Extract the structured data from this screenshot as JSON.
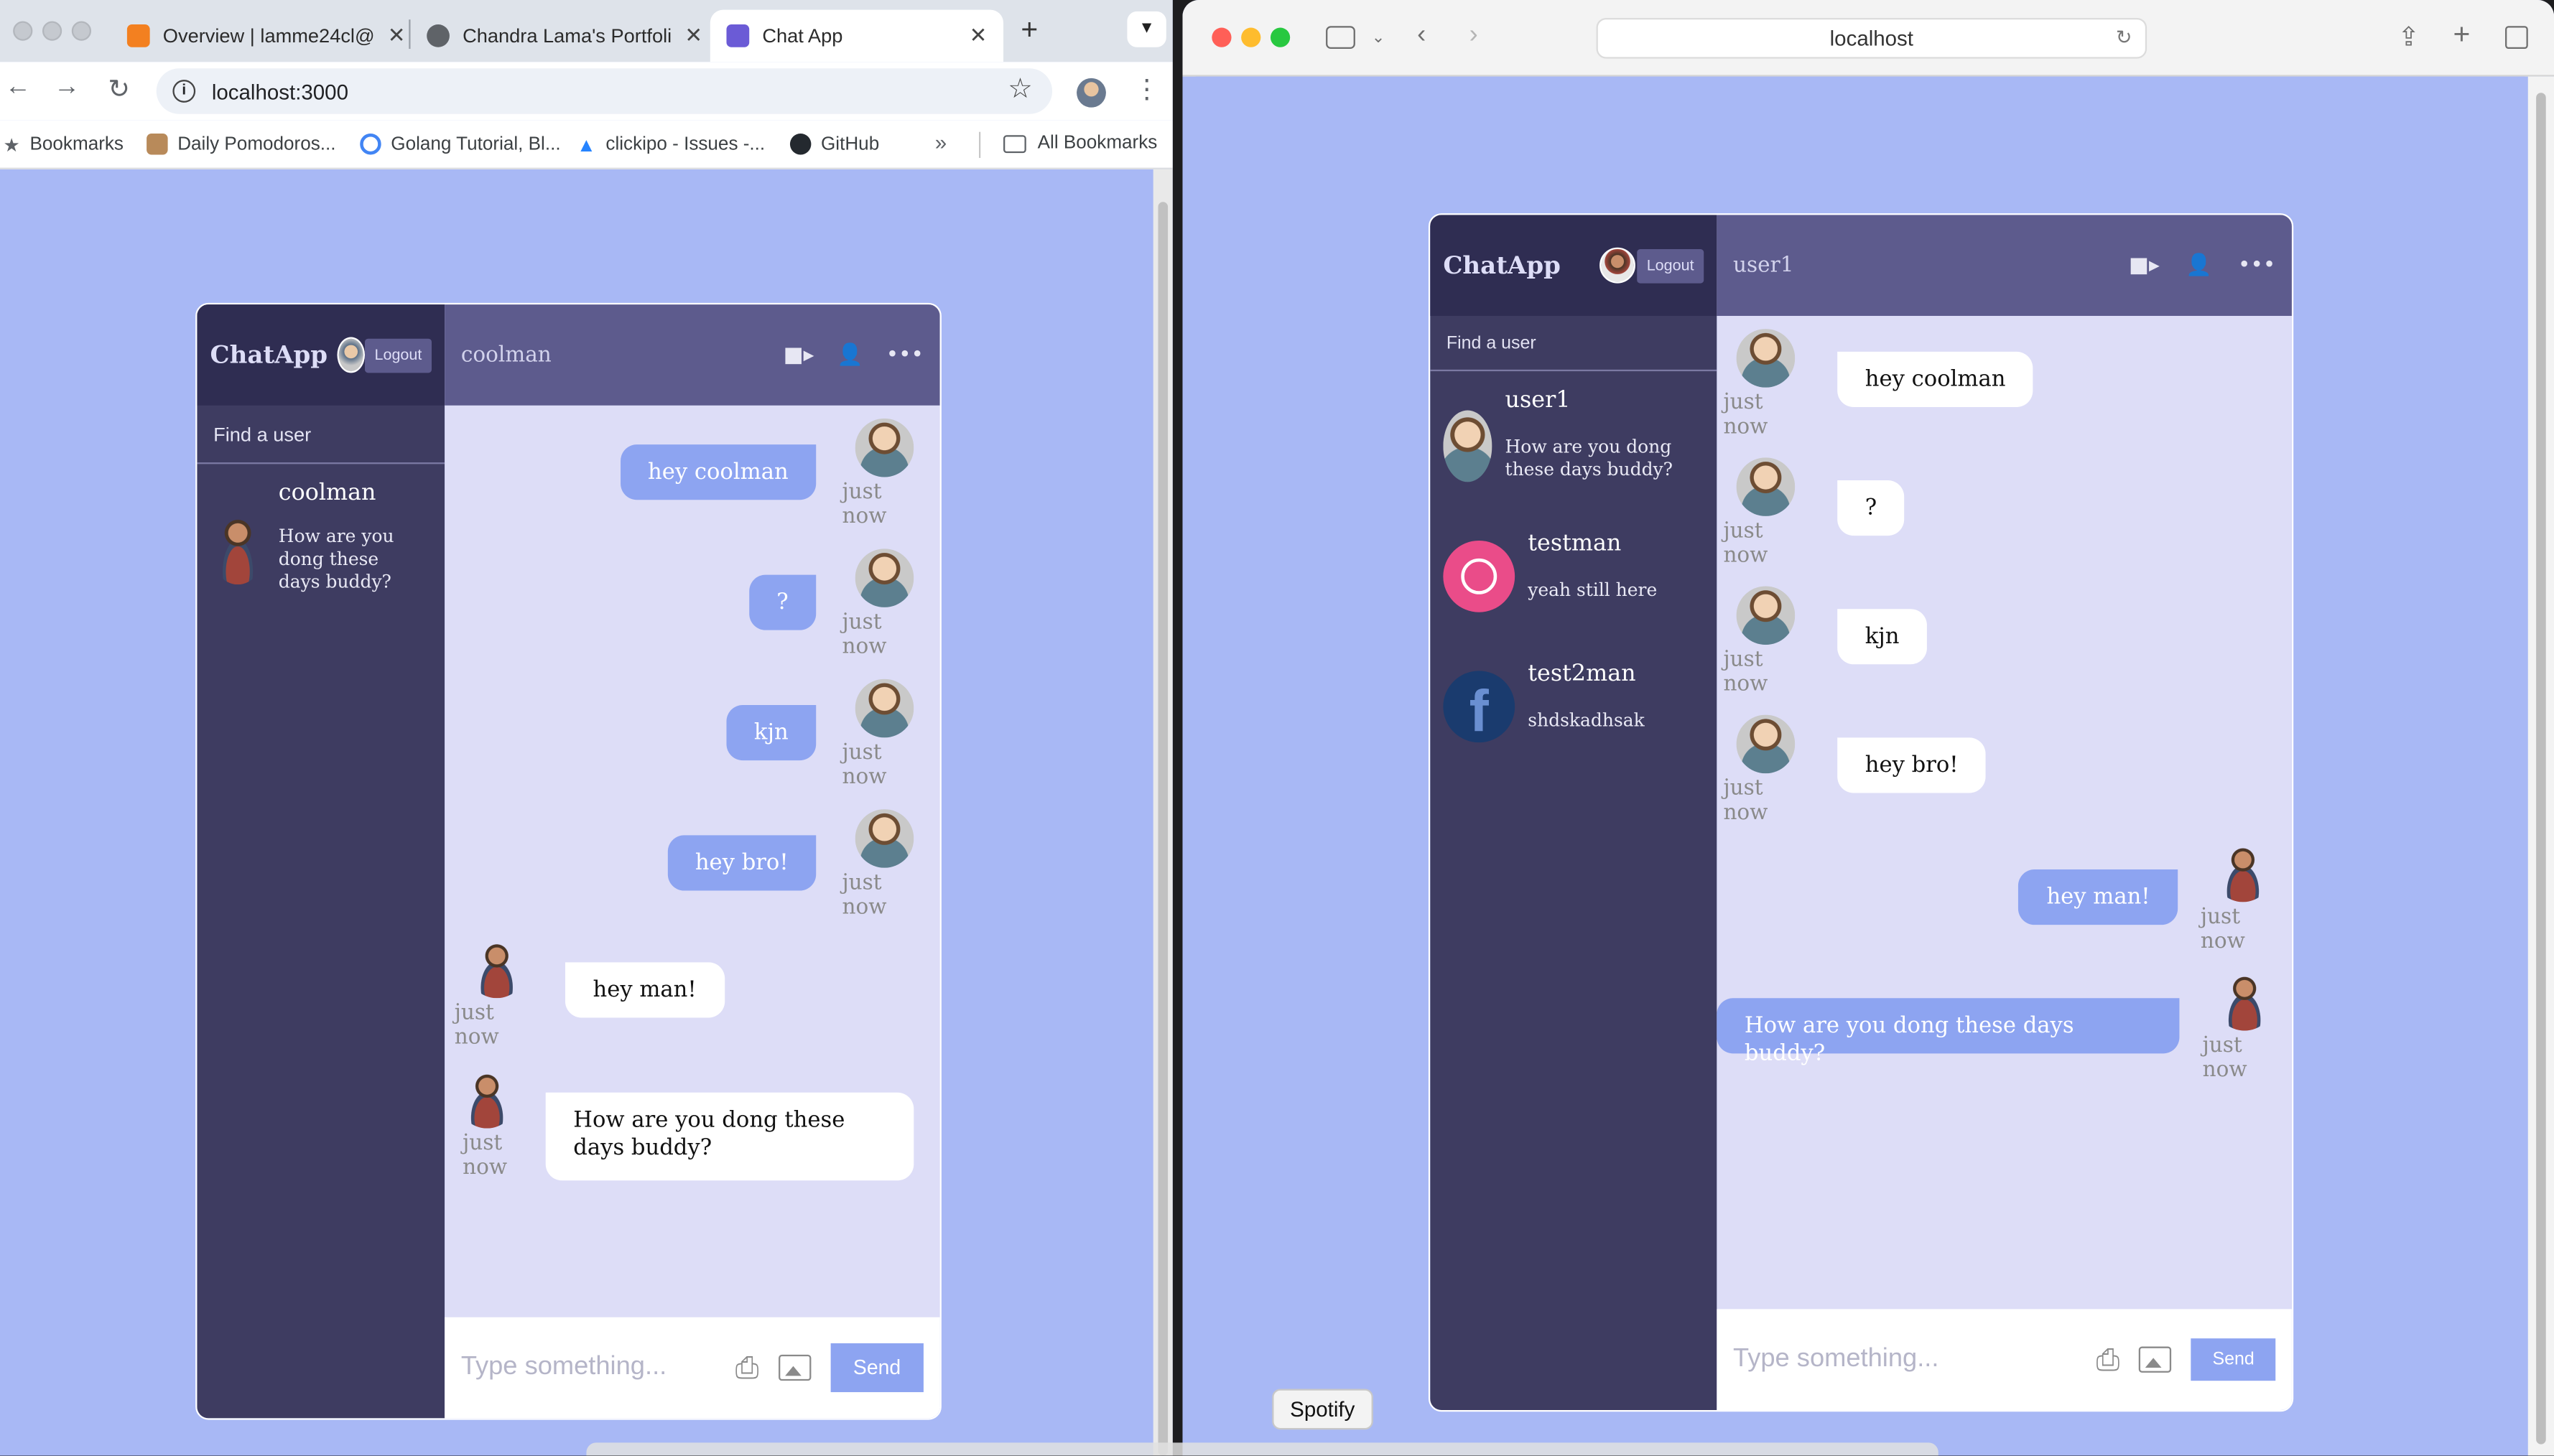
{
  "chrome": {
    "tabs": [
      {
        "title": "Overview | lamme24cl@",
        "icon_color": "#f38020"
      },
      {
        "title": "Chandra Lama's Portfoli",
        "icon_color": "#5f6368"
      },
      {
        "title": "Chat App",
        "icon_color": "#6b5bd6"
      }
    ],
    "url": "localhost:3000",
    "bookmarks": [
      {
        "label": "Bookmarks",
        "icon": "star-icon"
      },
      {
        "label": "Daily Pomodoros...",
        "icon": "pomodoro-icon"
      },
      {
        "label": "Golang Tutorial, Bl...",
        "icon": "google-icon"
      },
      {
        "label": "clickipo - Issues -...",
        "icon": "atlassian-icon"
      },
      {
        "label": "GitHub",
        "icon": "github-icon"
      },
      {
        "label": "All Bookmarks",
        "icon": "folder-icon"
      }
    ]
  },
  "safari": {
    "url": "localhost"
  },
  "tooltip": "Spotify",
  "left_app": {
    "brand": "ChatApp",
    "logout": "Logout",
    "search_placeholder": "Find a user",
    "current_chat_name": "coolman",
    "users": [
      {
        "name": "coolman",
        "last_message": "How are you dong these days buddy?"
      }
    ],
    "messages": [
      {
        "text": "hey coolman",
        "time": "just now",
        "owner": true
      },
      {
        "text": "?",
        "time": "just now",
        "owner": true
      },
      {
        "text": "kjn",
        "time": "just now",
        "owner": true
      },
      {
        "text": "hey bro!",
        "time": "just now",
        "owner": true
      },
      {
        "text": "hey man!",
        "time": "just now",
        "owner": false
      },
      {
        "text": "How are you dong these days buddy?",
        "time": "just now",
        "owner": false
      }
    ],
    "input_placeholder": "Type something...",
    "send": "Send"
  },
  "right_app": {
    "brand": "ChatApp",
    "logout": "Logout",
    "search_placeholder": "Find a user",
    "current_chat_name": "user1",
    "users": [
      {
        "name": "user1",
        "last_message": "How are you dong these days buddy?"
      },
      {
        "name": "testman",
        "last_message": "yeah still here"
      },
      {
        "name": "test2man",
        "last_message": "shdskadhsak"
      }
    ],
    "messages": [
      {
        "text": "hey coolman",
        "time": "just now",
        "owner": false
      },
      {
        "text": "?",
        "time": "just now",
        "owner": false
      },
      {
        "text": "kjn",
        "time": "just now",
        "owner": false
      },
      {
        "text": "hey bro!",
        "time": "just now",
        "owner": false
      },
      {
        "text": "hey man!",
        "time": "just now",
        "owner": true
      },
      {
        "text": "How are you dong these days buddy?",
        "time": "just now",
        "owner": true
      }
    ],
    "input_placeholder": "Type something...",
    "send": "Send"
  },
  "colors": {
    "page_bg": "#a8b8f5",
    "sidebar": "#3e3c61",
    "sidebar_nav": "#2f2d52",
    "chat_header": "#5d5b8d",
    "chat_bg": "#ddddf7",
    "owner_bubble": "#8da4f1"
  }
}
